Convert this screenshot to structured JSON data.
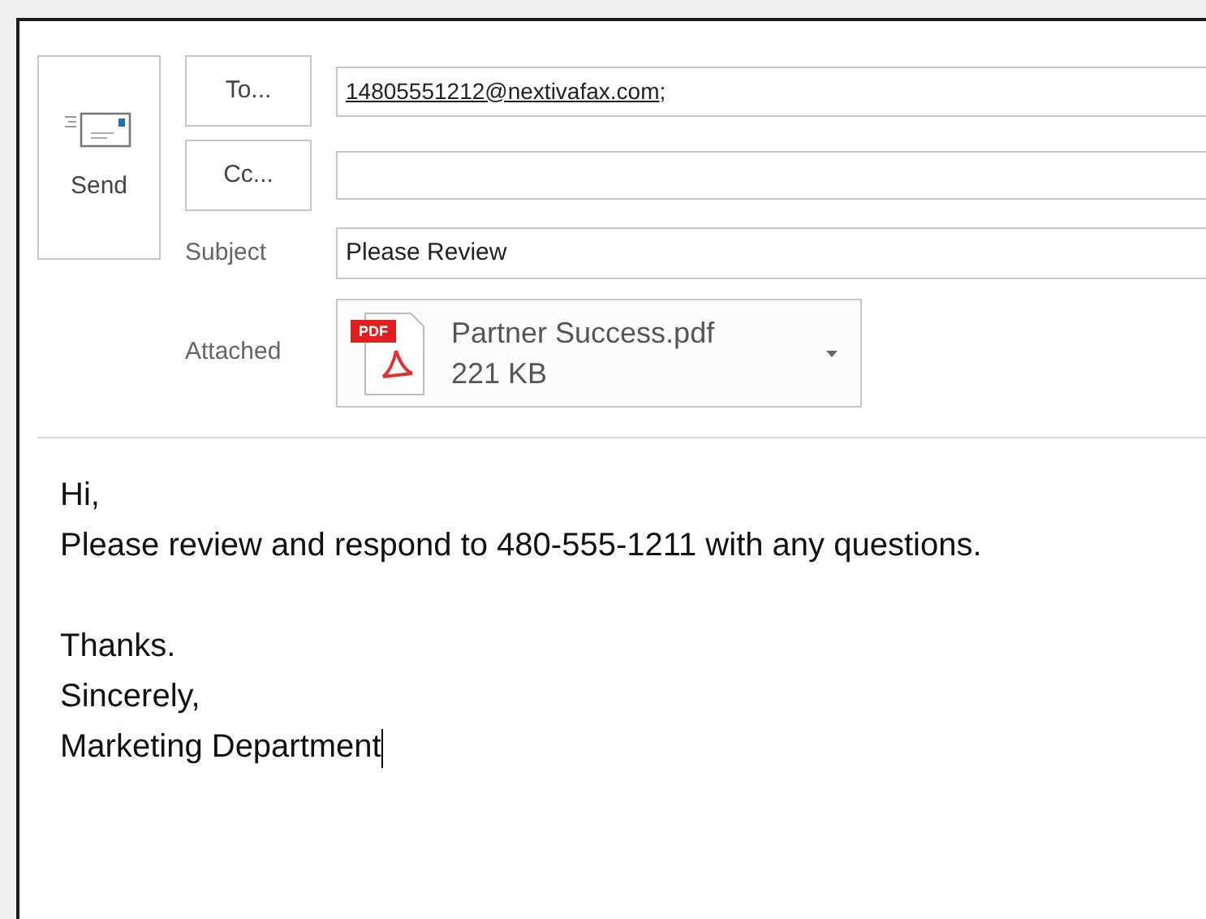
{
  "send_button": {
    "label": "Send"
  },
  "to": {
    "button": "To...",
    "value": "14805551212@nextivafax.com",
    "separator": ";"
  },
  "cc": {
    "button": "Cc..."
  },
  "subject": {
    "label": "Subject",
    "value": "Please Review"
  },
  "attachment": {
    "label": "Attached",
    "badge": "PDF",
    "name": "Partner Success.pdf",
    "size": "221 KB"
  },
  "body": {
    "paragraphs": [
      [
        "Hi,",
        "Please review and respond to 480-555-1211 with any questions."
      ],
      [
        "Thanks.",
        "Sincerely,",
        "Marketing Department"
      ]
    ]
  }
}
